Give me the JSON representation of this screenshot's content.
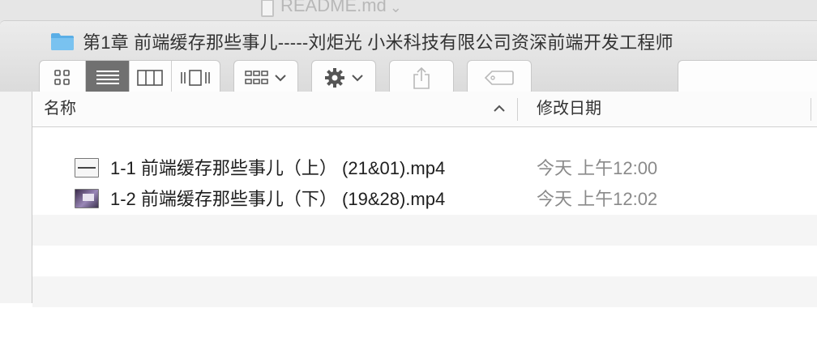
{
  "background_window": {
    "tab_label": "README.md",
    "tab_chevron": "⌄"
  },
  "window": {
    "folder_icon": "folder-icon",
    "title": "第1章 前端缓存那些事儿-----刘炬光  小米科技有限公司资深前端开发工程师"
  },
  "toolbar": {
    "view_modes": [
      "icon-view",
      "list-view",
      "column-view",
      "cover-flow-view"
    ],
    "active_view": "list-view",
    "arrange_button": "arrange-menu",
    "action_button": "gear-menu",
    "share_button": "share",
    "tags_button": "tags"
  },
  "columns": {
    "name": "名称",
    "date_modified": "修改日期",
    "sort": "ascending"
  },
  "files": [
    {
      "name": "1-1 前端缓存那些事儿（上） (21&01).mp4",
      "date": "今天 上午12:00",
      "thumbnail": "video-thumb-light"
    },
    {
      "name": "1-2 前端缓存那些事儿（下） (19&28).mp4",
      "date": "今天 上午12:02",
      "thumbnail": "video-thumb-purple"
    }
  ],
  "colors": {
    "active_segment": "#707070",
    "row_alt": "#f5f5f5",
    "folder_blue": "#5aaee6"
  }
}
